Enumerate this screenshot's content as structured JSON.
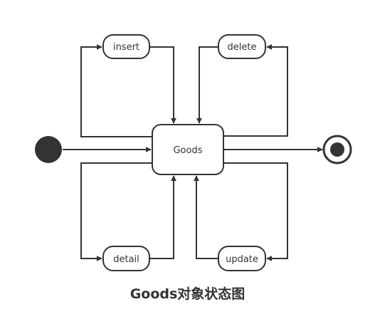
{
  "diagram": {
    "center_state": "Goods",
    "states": {
      "insert": "insert",
      "delete": "delete",
      "detail": "detail",
      "update": "update"
    },
    "caption": "Goods对象状态图"
  },
  "colors": {
    "stroke": "#333333",
    "fill": "#ffffff",
    "node": "#333333"
  }
}
